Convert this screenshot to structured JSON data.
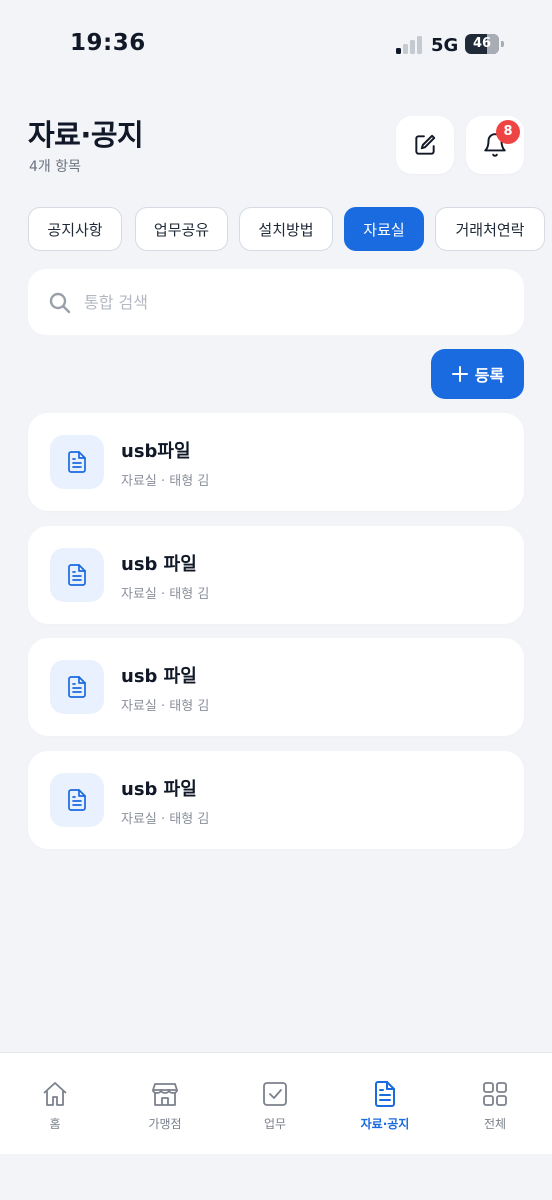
{
  "status_bar": {
    "time": "19:36",
    "network": "5G",
    "battery": "46"
  },
  "header": {
    "title": "자료·공지",
    "subtitle": "4개 항목",
    "edit_icon": "edit-icon",
    "bell_icon": "bell-icon",
    "notification_count": "8"
  },
  "tabs": [
    {
      "label": "공지사항",
      "active": false
    },
    {
      "label": "업무공유",
      "active": false
    },
    {
      "label": "설치방법",
      "active": false
    },
    {
      "label": "자료실",
      "active": true
    },
    {
      "label": "거래처연락",
      "active": false
    }
  ],
  "search": {
    "placeholder": "통합 검색",
    "value": ""
  },
  "register_button": {
    "label": "등록",
    "icon": "plus-icon"
  },
  "items": [
    {
      "title": "usb파일",
      "meta": "자료실 · 태형 김",
      "icon": "document-icon"
    },
    {
      "title": "usb 파일",
      "meta": "자료실 · 태형 김",
      "icon": "document-icon"
    },
    {
      "title": "usb 파일",
      "meta": "자료실 · 태형 김",
      "icon": "document-icon"
    },
    {
      "title": "usb 파일",
      "meta": "자료실 · 태형 김",
      "icon": "document-icon"
    }
  ],
  "bottom_nav": [
    {
      "label": "홈",
      "icon": "home-icon",
      "active": false
    },
    {
      "label": "가맹점",
      "icon": "store-icon",
      "active": false
    },
    {
      "label": "업무",
      "icon": "checkbox-icon",
      "active": false
    },
    {
      "label": "자료·공지",
      "icon": "document-icon",
      "active": true
    },
    {
      "label": "전체",
      "icon": "grid-icon",
      "active": false
    }
  ],
  "colors": {
    "accent": "#1a6ae0",
    "badge": "#ef4444",
    "background": "#f2f4f8",
    "icon_tile": "#e8f1fd"
  }
}
